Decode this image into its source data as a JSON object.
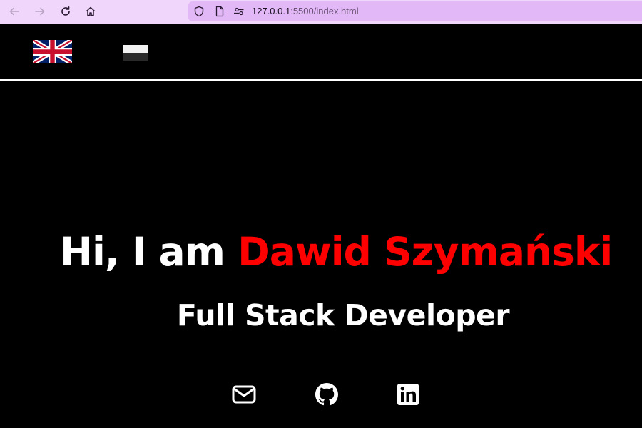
{
  "browser": {
    "url_host": "127.0.0.1",
    "url_rest": ":5500/index.html"
  },
  "header": {
    "languages": [
      {
        "code": "en",
        "icon": "uk-flag-icon"
      },
      {
        "code": "pl",
        "icon": "poland-flag-icon"
      }
    ]
  },
  "hero": {
    "greeting": "Hi, I am ",
    "name": "Dawid Szymański",
    "subtitle": "Full Stack Developer"
  },
  "social": [
    {
      "icon": "envelope-icon"
    },
    {
      "icon": "github-icon"
    },
    {
      "icon": "linkedin-icon"
    }
  ],
  "colors": {
    "accent": "#ff0000",
    "background": "#000000",
    "text": "#ffffff",
    "browser_bar": "#efd6fa",
    "url_bar": "#e2b8f6"
  }
}
